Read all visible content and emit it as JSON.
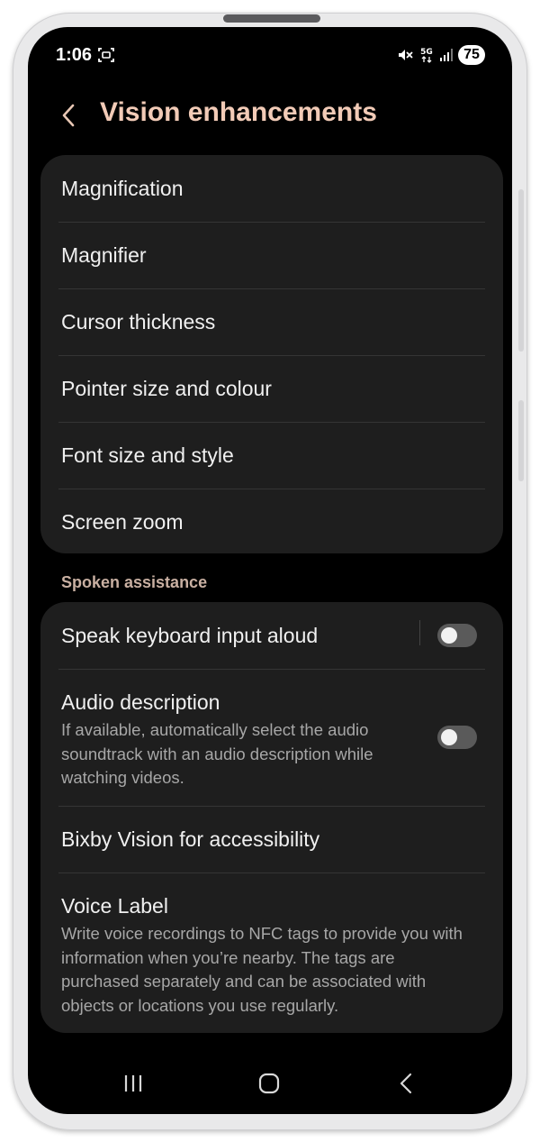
{
  "status": {
    "time": "1:06",
    "battery": "75",
    "network_label": "5G"
  },
  "header": {
    "title": "Vision enhancements"
  },
  "group1": {
    "items": [
      {
        "label": "Magnification"
      },
      {
        "label": "Magnifier"
      },
      {
        "label": "Cursor thickness"
      },
      {
        "label": "Pointer size and colour"
      },
      {
        "label": "Font size and style"
      },
      {
        "label": "Screen zoom"
      }
    ]
  },
  "section": {
    "title": "Spoken assistance"
  },
  "group2": {
    "speak_keyboard": {
      "label": "Speak keyboard input aloud",
      "enabled": false
    },
    "audio_description": {
      "label": "Audio description",
      "description": "If available, automatically select the audio soundtrack with an audio description while watching videos.",
      "enabled": false
    },
    "bixby_vision": {
      "label": "Bixby Vision for accessibility"
    },
    "voice_label": {
      "label": "Voice Label",
      "description": "Write voice recordings to NFC tags to provide you with information when you’re nearby. The tags are purchased separately and can be associated with objects or locations you use regularly."
    }
  },
  "colors": {
    "accent_title": "#f2cbb7",
    "section_header": "#c9b0a2",
    "card_bg": "#1e1e1e",
    "background": "#000000"
  },
  "icons": {
    "status": [
      "screenshot-icon",
      "mute-icon",
      "network-5g-icon",
      "signal-icon"
    ],
    "nav": [
      "recents-icon",
      "home-icon",
      "back-icon"
    ]
  }
}
